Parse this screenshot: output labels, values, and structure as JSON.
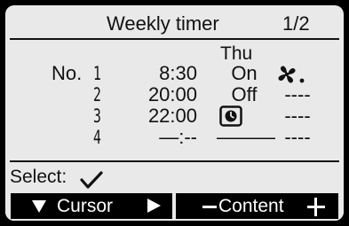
{
  "header": {
    "title": "Weekly timer",
    "page_indicator": "1/2"
  },
  "schedule": {
    "day": "Thu",
    "no_prefix": "No.",
    "rows": [
      {
        "no": "1",
        "time": "8:30",
        "state": "On",
        "mode": "",
        "mode_icon": "fan-icon"
      },
      {
        "no": "2",
        "time": "20:00",
        "state": "Off",
        "mode": "----"
      },
      {
        "no": "3",
        "time": "22:00",
        "state": "",
        "state_icon": "timer-icon",
        "mode": "----"
      },
      {
        "no": "4",
        "time": "—:--",
        "state": "———",
        "mode": "----"
      }
    ]
  },
  "footer": {
    "select_label": "Select:",
    "select_icon": "check-icon"
  },
  "softkeys": {
    "left_label": "Cursor",
    "right_label": "Content"
  }
}
